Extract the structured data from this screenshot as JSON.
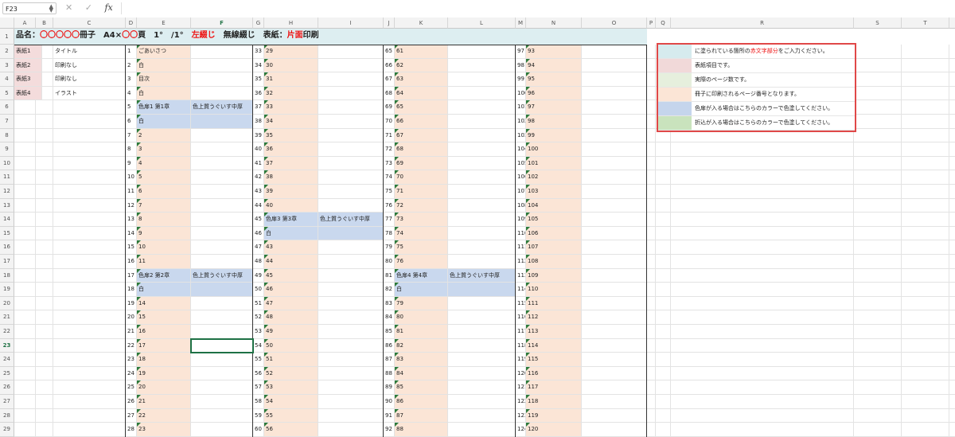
{
  "formula_bar": {
    "cell_ref": "F23",
    "fx_label": "fx",
    "formula": ""
  },
  "columns": [
    "A",
    "B",
    "C",
    "D",
    "E",
    "F",
    "G",
    "H",
    "I",
    "J",
    "K",
    "L",
    "M",
    "N",
    "O",
    "P",
    "Q",
    "R",
    "S",
    "T",
    "U"
  ],
  "selected": {
    "col": "F",
    "row": 23
  },
  "title": {
    "prefix": "品名：",
    "circles": "〇〇〇〇〇",
    "p2": "冊子　A4×",
    "pages": "〇〇",
    "p3": "頁　1°　/1°　",
    "binding": "左綴じ",
    "p4": "　無線綴じ　表紙：",
    "print_side": "片面",
    "p5": "印刷"
  },
  "cover": [
    {
      "label": "表紙1",
      "value": "タイトル"
    },
    {
      "label": "表紙2",
      "value": "印刷なし"
    },
    {
      "label": "表紙3",
      "value": "印刷なし"
    },
    {
      "label": "表紙4",
      "value": "イラスト"
    }
  ],
  "page_text": {
    "1": "ごあいさつ",
    "2": "白",
    "3": "目次",
    "4": "白",
    "5": "色扉1 第1章",
    "6": "白",
    "17": "色扉2 第2章",
    "18": "白",
    "41": "色扉3 第3章",
    "42": "白",
    "77": "色扉4 第4章",
    "78": "白"
  },
  "paper_note": "色上質うぐいす中厚",
  "legend": [
    {
      "color": "#d6ebee",
      "text_parts": [
        "に塗られている箇所の",
        "赤文字部分",
        "をご入力ください。"
      ]
    },
    {
      "color": "#f1d9d9",
      "text_parts": [
        "表紙項目です。",
        "",
        ""
      ]
    },
    {
      "color": "#e6efdd",
      "text_parts": [
        "実際のページ数です。",
        "",
        ""
      ]
    },
    {
      "color": "#fbe5d6",
      "text_parts": [
        "冊子に印刷されるページ番号となります。",
        "",
        ""
      ]
    },
    {
      "color": "#c5d5ec",
      "text_parts": [
        "色扉が入る場合はこちらのカラーで色塗してください。",
        "",
        ""
      ]
    },
    {
      "color": "#c9e3bd",
      "text_parts": [
        "折込が入る場合はこちらのカラーで色塗してください。",
        "",
        ""
      ]
    }
  ],
  "colors": {
    "accent_green": "#217346",
    "peach": "#fbe5d6",
    "blue": "#c9d8ee",
    "red": "#e11111"
  }
}
